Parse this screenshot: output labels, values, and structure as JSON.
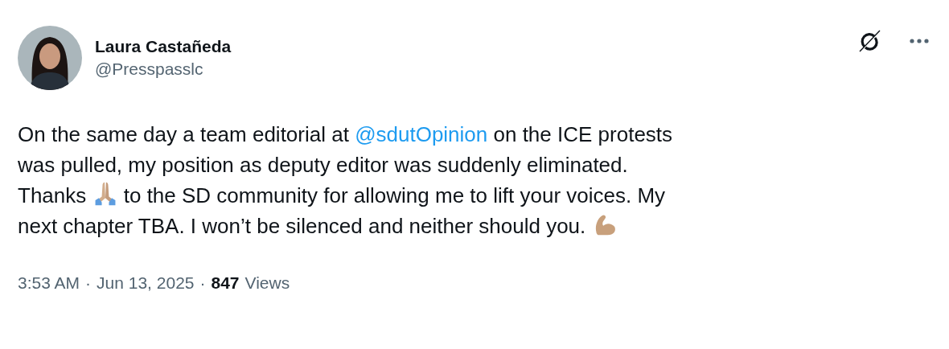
{
  "author": {
    "name": "Laura Castañeda",
    "handle": "@Presspasslc"
  },
  "text_lines": [
    [
      {
        "kind": "text",
        "text": "On the same day a team editorial at "
      },
      {
        "kind": "mention",
        "text": "@sdutOpinion"
      },
      {
        "kind": "text",
        "text": " on the ICE protests"
      }
    ],
    [
      {
        "kind": "text",
        "text": "was pulled, my position as deputy editor was suddenly eliminated."
      }
    ],
    [
      {
        "kind": "text",
        "text": "Thanks "
      },
      {
        "kind": "hands"
      },
      {
        "kind": "text",
        "text": " to the SD community for allowing me to lift your voices. My"
      }
    ],
    [
      {
        "kind": "text",
        "text": "next chapter TBA. I won’t be silenced and neither should you. "
      },
      {
        "kind": "arm"
      }
    ]
  ],
  "meta": {
    "time": "3:53 AM",
    "separator_1": "·",
    "date": "Jun 13, 2025",
    "separator_2": "·",
    "views_count": "847",
    "views_label": "Views"
  }
}
